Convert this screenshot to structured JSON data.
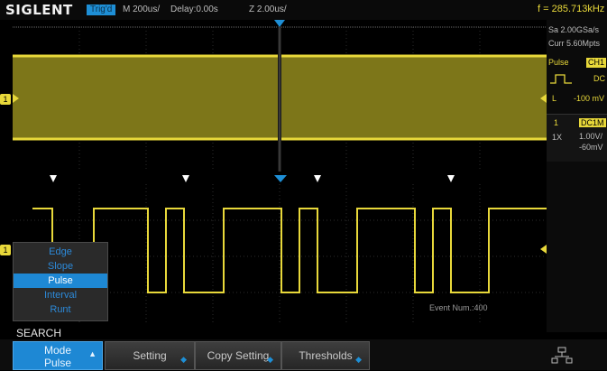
{
  "topbar": {
    "brand": "SIGLENT",
    "trigger_state": "Trig'd",
    "timebase": "M 200us/",
    "delay": "Delay:0.00s",
    "zoom_timebase": "Z 2.00us/",
    "frequency": "f = 285.713kHz"
  },
  "right_panel": {
    "sample_rate": "Sa 2.00GSa/s",
    "memory_depth": "Curr 5.60Mpts",
    "trigger_type": "Pulse",
    "trigger_source": "CH1",
    "coupling": "DC",
    "level_label": "L",
    "level_value": "-100 mV",
    "channel_number": "1",
    "channel_coupling": "DC1M",
    "probe": "1X",
    "volts_div": "1.00V/",
    "offset": "-60mV"
  },
  "markers": {
    "channel_1": "1"
  },
  "search_menu": {
    "items": [
      "Edge",
      "Slope",
      "Pulse",
      "Interval",
      "Runt"
    ],
    "selected": "Pulse"
  },
  "search_label": "SEARCH",
  "event_num": "Event Num.:400",
  "softkeys": {
    "mode_label": "Mode",
    "mode_value": "Pulse",
    "setting": "Setting",
    "copy_setting": "Copy Setting",
    "thresholds": "Thresholds"
  },
  "colors": {
    "ch1": "#e8d83a",
    "accent": "#1e88d4"
  }
}
